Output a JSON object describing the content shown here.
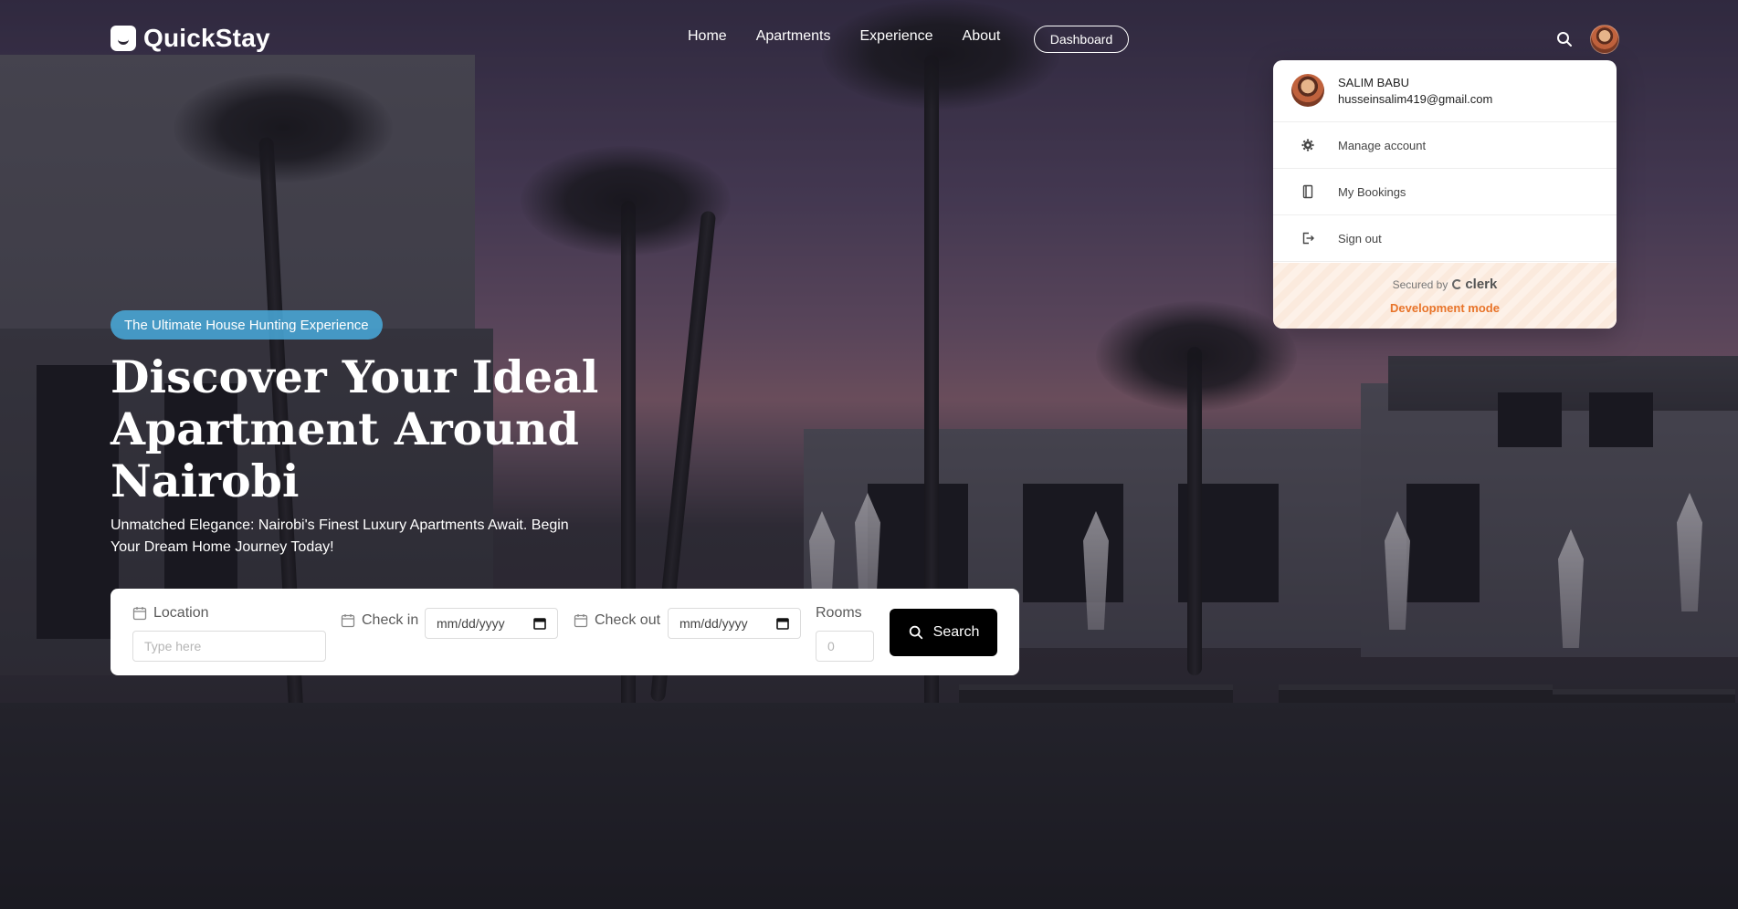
{
  "brand": {
    "name": "QuickStay"
  },
  "nav": {
    "links": [
      "Home",
      "Apartments",
      "Experience",
      "About"
    ],
    "dashboard_label": "Dashboard"
  },
  "hero": {
    "badge": "The Ultimate House Hunting Experience",
    "title": "Discover Your Ideal Apartment Around Nairobi",
    "subtitle": "Unmatched Elegance: Nairobi's Finest Luxury Apartments Await. Begin Your Dream Home Journey Today!"
  },
  "search_form": {
    "location_label": "Location",
    "location_placeholder": "Type here",
    "checkin_label": "Check in",
    "checkin_value": "mm/dd/yyyy",
    "checkout_label": "Check out",
    "checkout_value": "mm/dd/yyyy",
    "rooms_label": "Rooms",
    "rooms_placeholder": "0",
    "search_label": "Search"
  },
  "user_menu": {
    "name": "SALIM BABU",
    "email": "husseinsalim419@gmail.com",
    "items": [
      {
        "label": "Manage account",
        "icon": "gear-icon"
      },
      {
        "label": "My Bookings",
        "icon": "book-icon"
      },
      {
        "label": "Sign out",
        "icon": "sign-out-icon"
      }
    ],
    "secured_by": "Secured by",
    "provider": "clerk",
    "mode": "Development mode"
  },
  "colors": {
    "badge_bg": "#49AADC",
    "search_button": "#000000",
    "dev_mode": "#E8742A"
  }
}
